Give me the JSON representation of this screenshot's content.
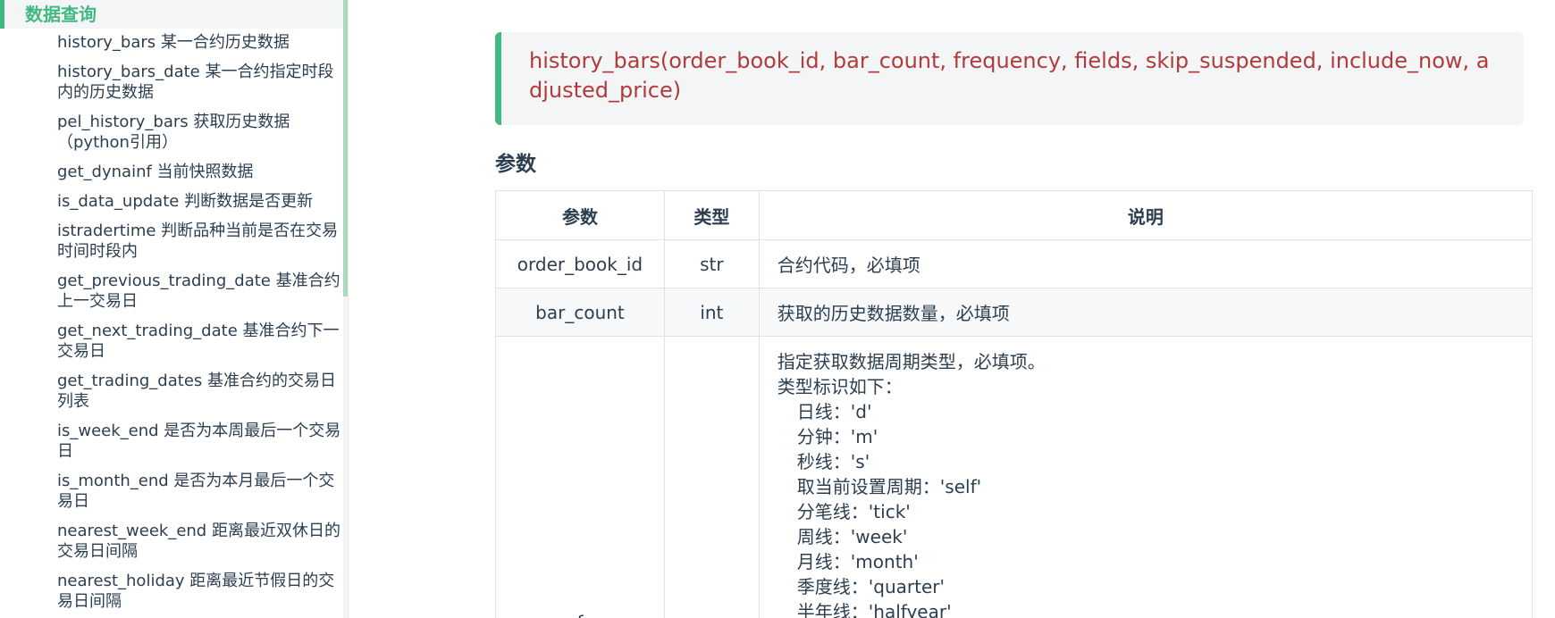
{
  "sidebar": {
    "heading": "数据查询",
    "items": [
      "history_bars 某一合约历史数据",
      "history_bars_date 某一合约指定时段内的历史数据",
      "pel_history_bars 获取历史数据（python引用）",
      "get_dynainf 当前快照数据",
      "is_data_update 判断数据是否更新",
      "istradertime 判断品种当前是否在交易时间时段内",
      "get_previous_trading_date 基准合约上一交易日",
      "get_next_trading_date 基准合约下一交易日",
      "get_trading_dates 基准合约的交易日列表",
      "is_week_end 是否为本周最后一个交易日",
      "is_month_end 是否为本月最后一个交易日",
      "nearest_week_end 距离最近双休日的交易日间隔",
      "nearest_holiday 距离最近节假日的交易日间隔"
    ]
  },
  "main": {
    "signature": "history_bars(order_book_id, bar_count, frequency, fields, skip_suspended, include_now, adjusted_price)",
    "section_title": "参数",
    "table": {
      "headers": [
        "参数",
        "类型",
        "说明"
      ],
      "rows": [
        {
          "name": "order_book_id",
          "type": "str",
          "desc": "合约代码，必填项"
        },
        {
          "name": "bar_count",
          "type": "int",
          "desc": "获取的历史数据数量，必填项"
        }
      ],
      "frequency_row": {
        "name": "f",
        "type": "",
        "desc_lines": [
          "指定获取数据周期类型，必填项。",
          "类型标识如下："
        ],
        "desc_sub_lines": [
          "日线：'d'",
          "分钟：'m'",
          "秒线：'s'",
          "取当前设置周期：'self'",
          "分笔线：'tick'",
          "周线：'week'",
          "月线：'month'",
          "季度线：'quarter'",
          "半年线：'halfyear'"
        ]
      }
    }
  },
  "colors": {
    "accent": "#42b983",
    "signature_text": "#b33a3a",
    "text": "#2c3e50"
  }
}
